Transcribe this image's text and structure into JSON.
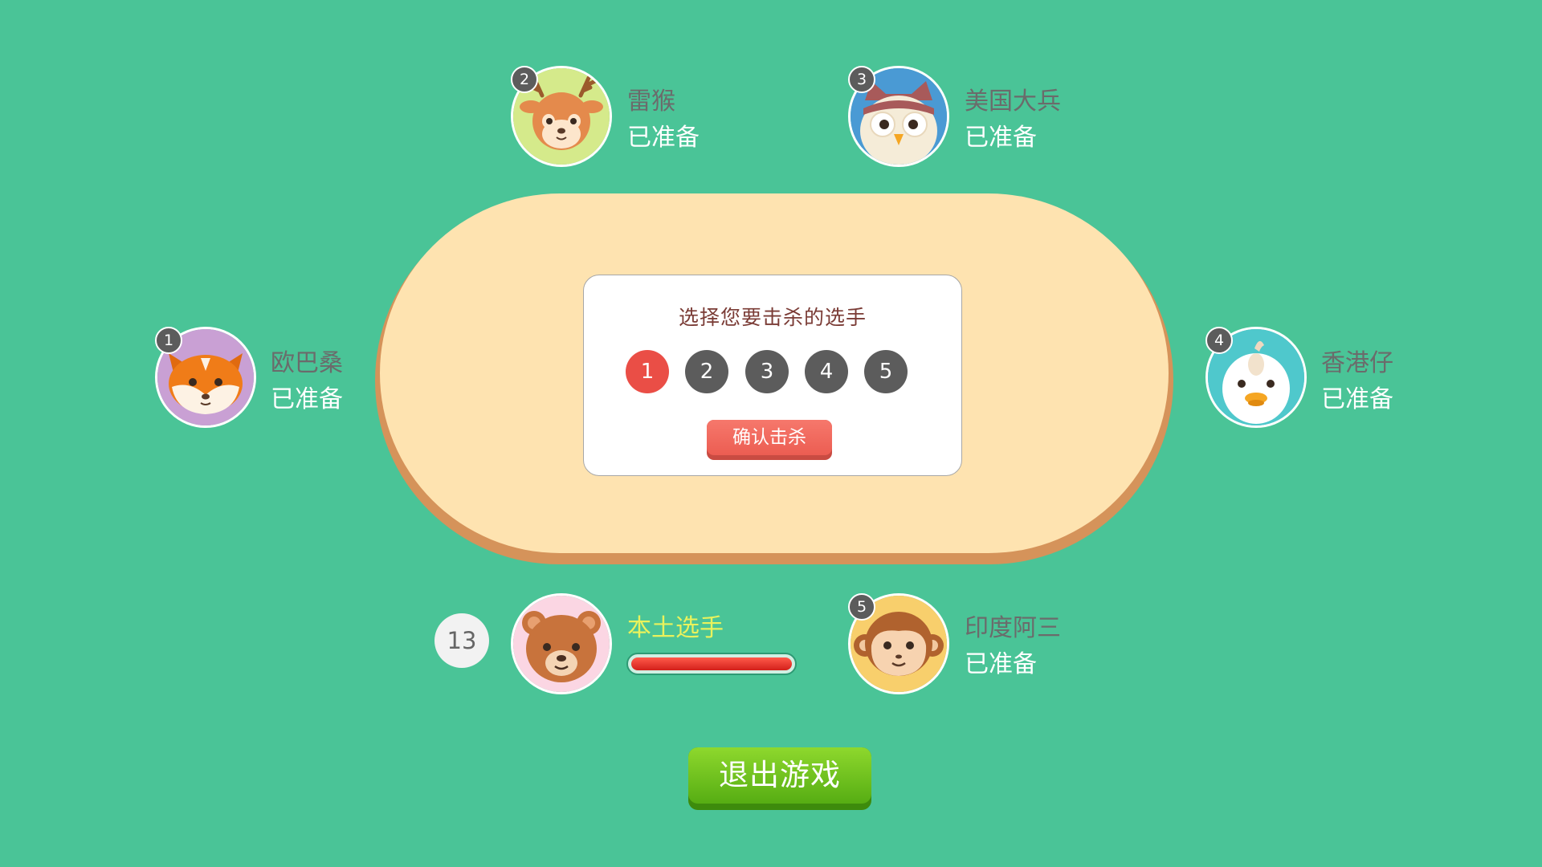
{
  "dialog": {
    "title": "选择您要击杀的选手",
    "numbers": [
      "1",
      "2",
      "3",
      "4",
      "5"
    ],
    "selected": "1",
    "confirm_label": "确认击杀"
  },
  "players": [
    {
      "seat": "1",
      "name": "欧巴桑",
      "status": "已准备",
      "animal": "fox",
      "avatar_bg": "#c9a0d4"
    },
    {
      "seat": "2",
      "name": "雷猴",
      "status": "已准备",
      "animal": "deer",
      "avatar_bg": "#d5ea8b"
    },
    {
      "seat": "3",
      "name": "美国大兵",
      "status": "已准备",
      "animal": "owl",
      "avatar_bg": "#4a9ad4"
    },
    {
      "seat": "4",
      "name": "香港仔",
      "status": "已准备",
      "animal": "duck",
      "avatar_bg": "#4fc8cc"
    },
    {
      "seat": "5",
      "name": "印度阿三",
      "status": "已准备",
      "animal": "monkey",
      "avatar_bg": "#f8cf6c"
    }
  ],
  "self": {
    "name": "本土选手",
    "animal": "bear",
    "avatar_bg": "#fbd6e3",
    "timer": "13",
    "progress": 1.0
  },
  "exit_label": "退出游戏",
  "colors": {
    "background": "#4ac497",
    "table": "#fee3b0",
    "table_edge": "#d5935a",
    "selected_number": "#ea4e46",
    "confirm_button": "#ec5d52",
    "exit_button": "#6cc11d"
  }
}
